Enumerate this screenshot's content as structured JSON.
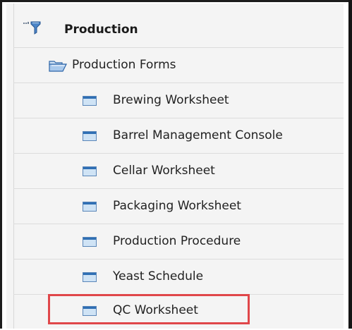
{
  "tree": {
    "section": {
      "label": "Production",
      "icon": "module-filter-icon"
    },
    "folder": {
      "label": "Production Forms",
      "icon": "open-folder-icon"
    },
    "forms": [
      {
        "label": "Brewing Worksheet",
        "icon": "form-icon"
      },
      {
        "label": "Barrel Management Console",
        "icon": "form-icon"
      },
      {
        "label": "Cellar Worksheet",
        "icon": "form-icon"
      },
      {
        "label": "Packaging Worksheet",
        "icon": "form-icon"
      },
      {
        "label": "Production Procedure",
        "icon": "form-icon"
      },
      {
        "label": "Yeast Schedule",
        "icon": "form-icon"
      },
      {
        "label": "QC Worksheet",
        "icon": "form-icon",
        "highlighted": true
      }
    ]
  },
  "colors": {
    "highlight_border": "#e0474a",
    "form_icon_blue": "#2f6fb4",
    "folder_icon_blue": "#3b79c2"
  }
}
